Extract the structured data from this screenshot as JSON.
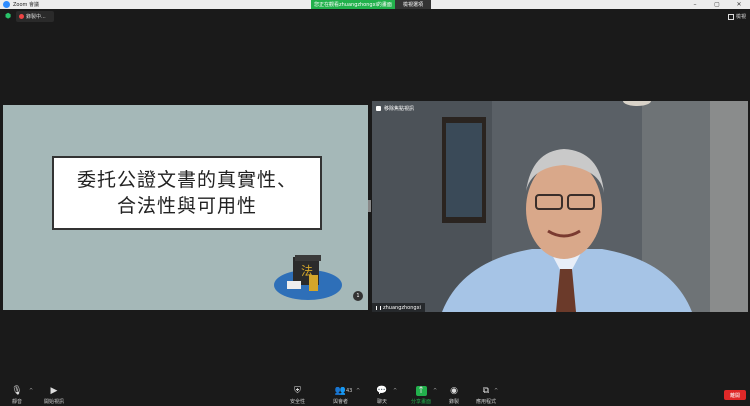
{
  "window": {
    "title": "Zoom 會議",
    "share_banner": "您正在觀看zhuangzhongxi的畫面",
    "stop_share": "檢視選項"
  },
  "topbar": {
    "recording_label": "錄製中...",
    "view_label": "檢視"
  },
  "slide": {
    "title_line1": "委托公證文書的真實性、",
    "title_line2": "合法性與可用性",
    "page_number": "1"
  },
  "video": {
    "spotlight_label": "移除焦點視訊",
    "participant_name": "zhuangzhongxi"
  },
  "toolbar": {
    "audio": "靜音",
    "video": "開始視訊",
    "security": "安全性",
    "participants": "與會者",
    "participants_count": "43",
    "chat": "聊天",
    "share": "分享畫面",
    "record": "錄製",
    "apps": "應用程式",
    "end": "離開"
  },
  "colors": {
    "share_green": "#22b14c",
    "end_red": "#e02828",
    "slide_bg": "#a5b8b8"
  }
}
